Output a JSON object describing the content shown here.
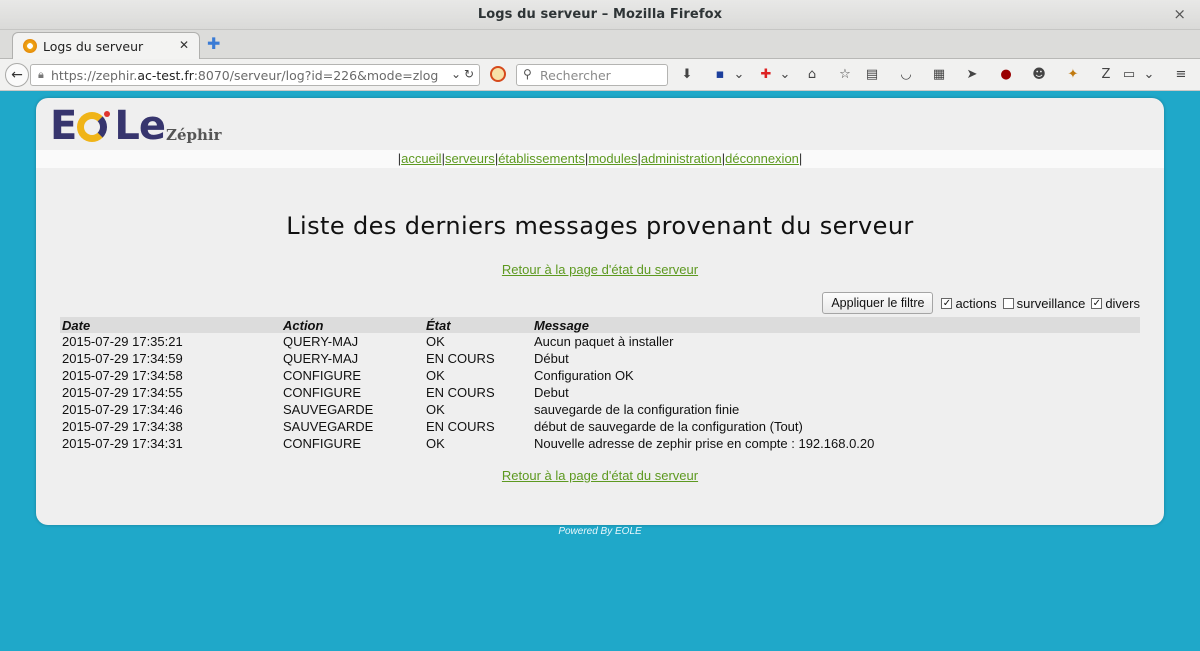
{
  "window": {
    "title": "Logs du serveur – Mozilla Firefox",
    "close_glyph": "×"
  },
  "tab": {
    "title": "Logs du serveur",
    "close_glyph": "✕",
    "newtab_glyph": "✚"
  },
  "navbar": {
    "url_prefix": "https://zephir.",
    "url_host": "ac-test.fr",
    "url_rest": ":8070/serveur/log?id=226&mode=zlog",
    "search_placeholder": "Rechercher"
  },
  "site": {
    "logo_text_left": "E",
    "logo_text_right": "Le",
    "brand_sub": "Zéphir"
  },
  "menu": {
    "items": [
      "accueil",
      "serveurs",
      "établissements",
      "modules",
      "administration",
      "déconnexion"
    ]
  },
  "main": {
    "heading": "Liste des derniers messages provenant du serveur",
    "back_link": "Retour à la page d'état du serveur",
    "apply_button": "Appliquer le filtre",
    "filters": [
      {
        "label": "actions",
        "checked": true
      },
      {
        "label": "surveillance",
        "checked": false
      },
      {
        "label": "divers",
        "checked": true
      }
    ]
  },
  "table": {
    "headers": [
      "Date",
      "Action",
      "État",
      "Message"
    ],
    "rows": [
      [
        "2015-07-29 17:35:21",
        "QUERY-MAJ",
        "OK",
        "Aucun paquet à installer"
      ],
      [
        "2015-07-29 17:34:59",
        "QUERY-MAJ",
        "EN COURS",
        "Début"
      ],
      [
        "2015-07-29 17:34:58",
        "CONFIGURE",
        "OK",
        "Configuration OK"
      ],
      [
        "2015-07-29 17:34:55",
        "CONFIGURE",
        "EN COURS",
        "Debut"
      ],
      [
        "2015-07-29 17:34:46",
        "SAUVEGARDE",
        "OK",
        "sauvegarde de la configuration finie"
      ],
      [
        "2015-07-29 17:34:38",
        "SAUVEGARDE",
        "EN COURS",
        "début de sauvegarde de la configuration (Tout)"
      ],
      [
        "2015-07-29 17:34:31",
        "CONFIGURE",
        "OK",
        "Nouvelle adresse de zephir prise en compte : 192.168.0.20"
      ]
    ]
  },
  "footer": {
    "text": "Powered By EOLE"
  },
  "colors": {
    "background": "#1fa8c9",
    "link": "#5d9920",
    "panel": "#efefef"
  }
}
